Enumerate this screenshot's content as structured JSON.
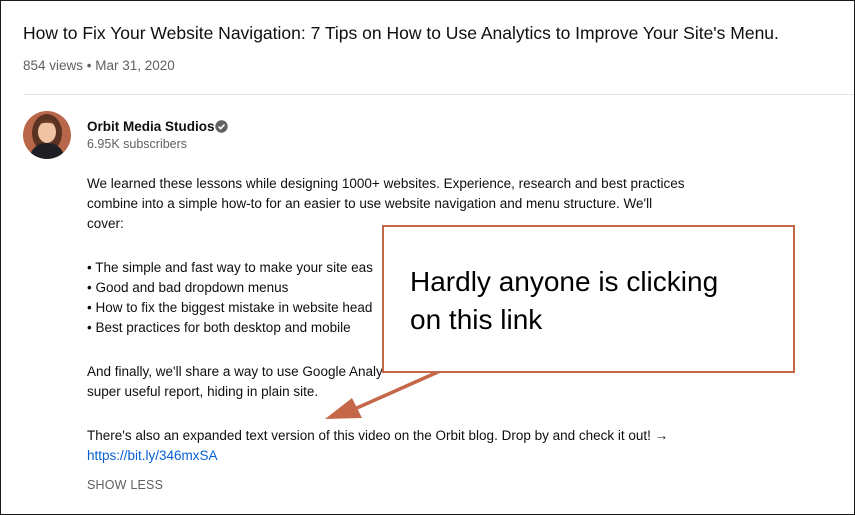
{
  "video": {
    "title": "How to Fix Your Website Navigation: 7 Tips on How to Use Analytics to Improve Your Site's Menu.",
    "meta": "854 views • Mar 31, 2020"
  },
  "channel": {
    "name": "Orbit Media Studios",
    "subscribers": "6.95K subscribers",
    "avatar_icon": "person-avatar-icon",
    "verified_icon": "verified-check-icon"
  },
  "description": {
    "lines": [
      "We learned these lessons while designing 1000+ websites. Experience, research and best practices",
      "combine into a simple how-to for an easier to use website navigation and menu structure. We'll",
      "cover:",
      "• The simple and fast way to make your site eas",
      "• Good and bad dropdown menus",
      "• How to fix the biggest mistake in website head",
      "• Best practices for both desktop and mobile",
      "And finally, we'll share a way to use Google Analy",
      "super useful report, hiding in plain site.",
      "There's also an expanded text version of this video on the Orbit blog. Drop by and check it out! →"
    ],
    "link": "https://bit.ly/346mxSA",
    "show_less": "SHOW LESS"
  },
  "annotation": {
    "line1": "Hardly anyone is clicking",
    "line2": "on this link",
    "accent_color": "#c5684a",
    "arrow_icon": "callout-arrow-icon"
  }
}
